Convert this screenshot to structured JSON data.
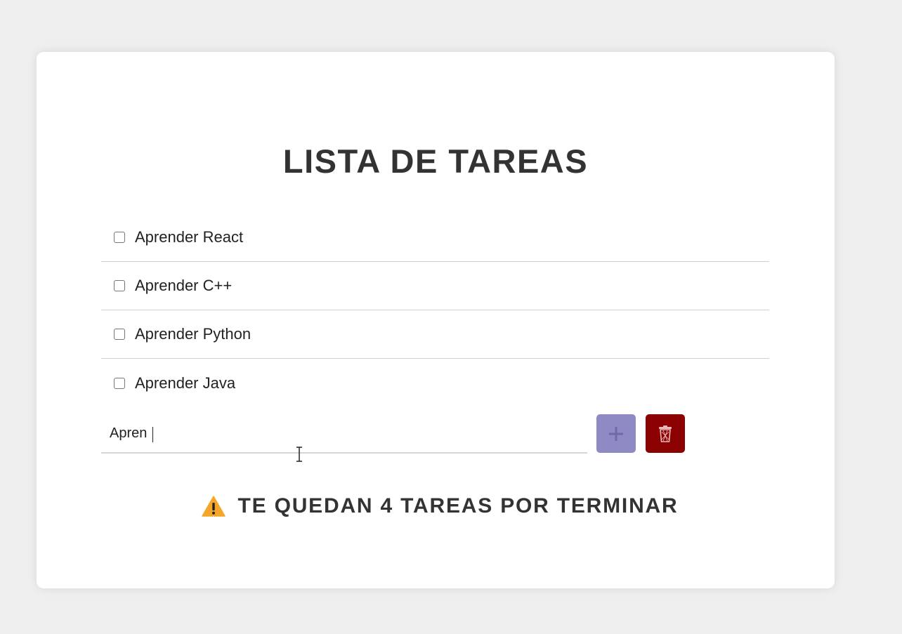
{
  "app": {
    "title": "LISTA DE TAREAS"
  },
  "tasks": [
    {
      "label": "Aprender React",
      "done": false
    },
    {
      "label": "Aprender C++",
      "done": false
    },
    {
      "label": "Aprender Python",
      "done": false
    },
    {
      "label": "Aprender Java",
      "done": false
    }
  ],
  "new_task": {
    "value": "Apren",
    "placeholder": ""
  },
  "buttons": {
    "add_icon": "plus-icon",
    "clear_icon": "trash-icon"
  },
  "status": {
    "icon": "warning-icon",
    "text": "TE QUEDAN 4 TAREAS POR TERMINAR"
  },
  "colors": {
    "background": "#efefef",
    "card": "#ffffff",
    "text": "#333333",
    "add_button": "#8f8ac3",
    "clear_button": "#8b0000",
    "warning": "#f4a62a"
  }
}
